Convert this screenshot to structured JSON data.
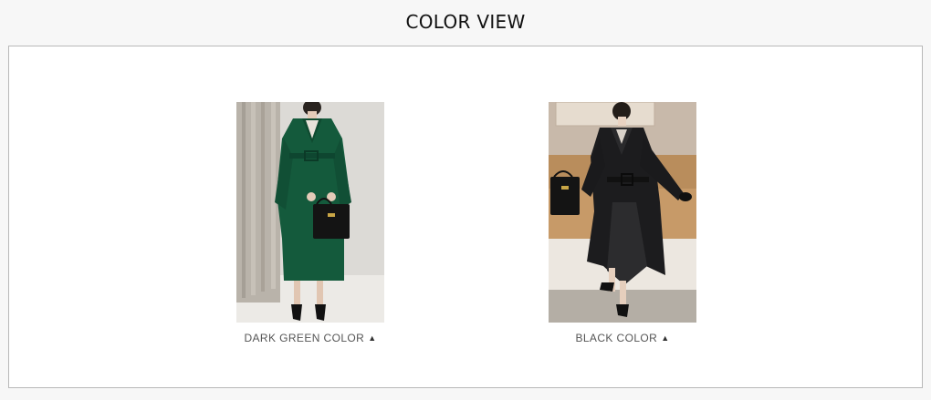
{
  "header": {
    "title": "COLOR VIEW"
  },
  "items": [
    {
      "label": "DARK GREEN COLOR",
      "arrow": "▲",
      "coat_color": "#145a3c"
    },
    {
      "label": "BLACK COLOR",
      "arrow": "▲",
      "coat_color": "#1c1c1e"
    }
  ]
}
